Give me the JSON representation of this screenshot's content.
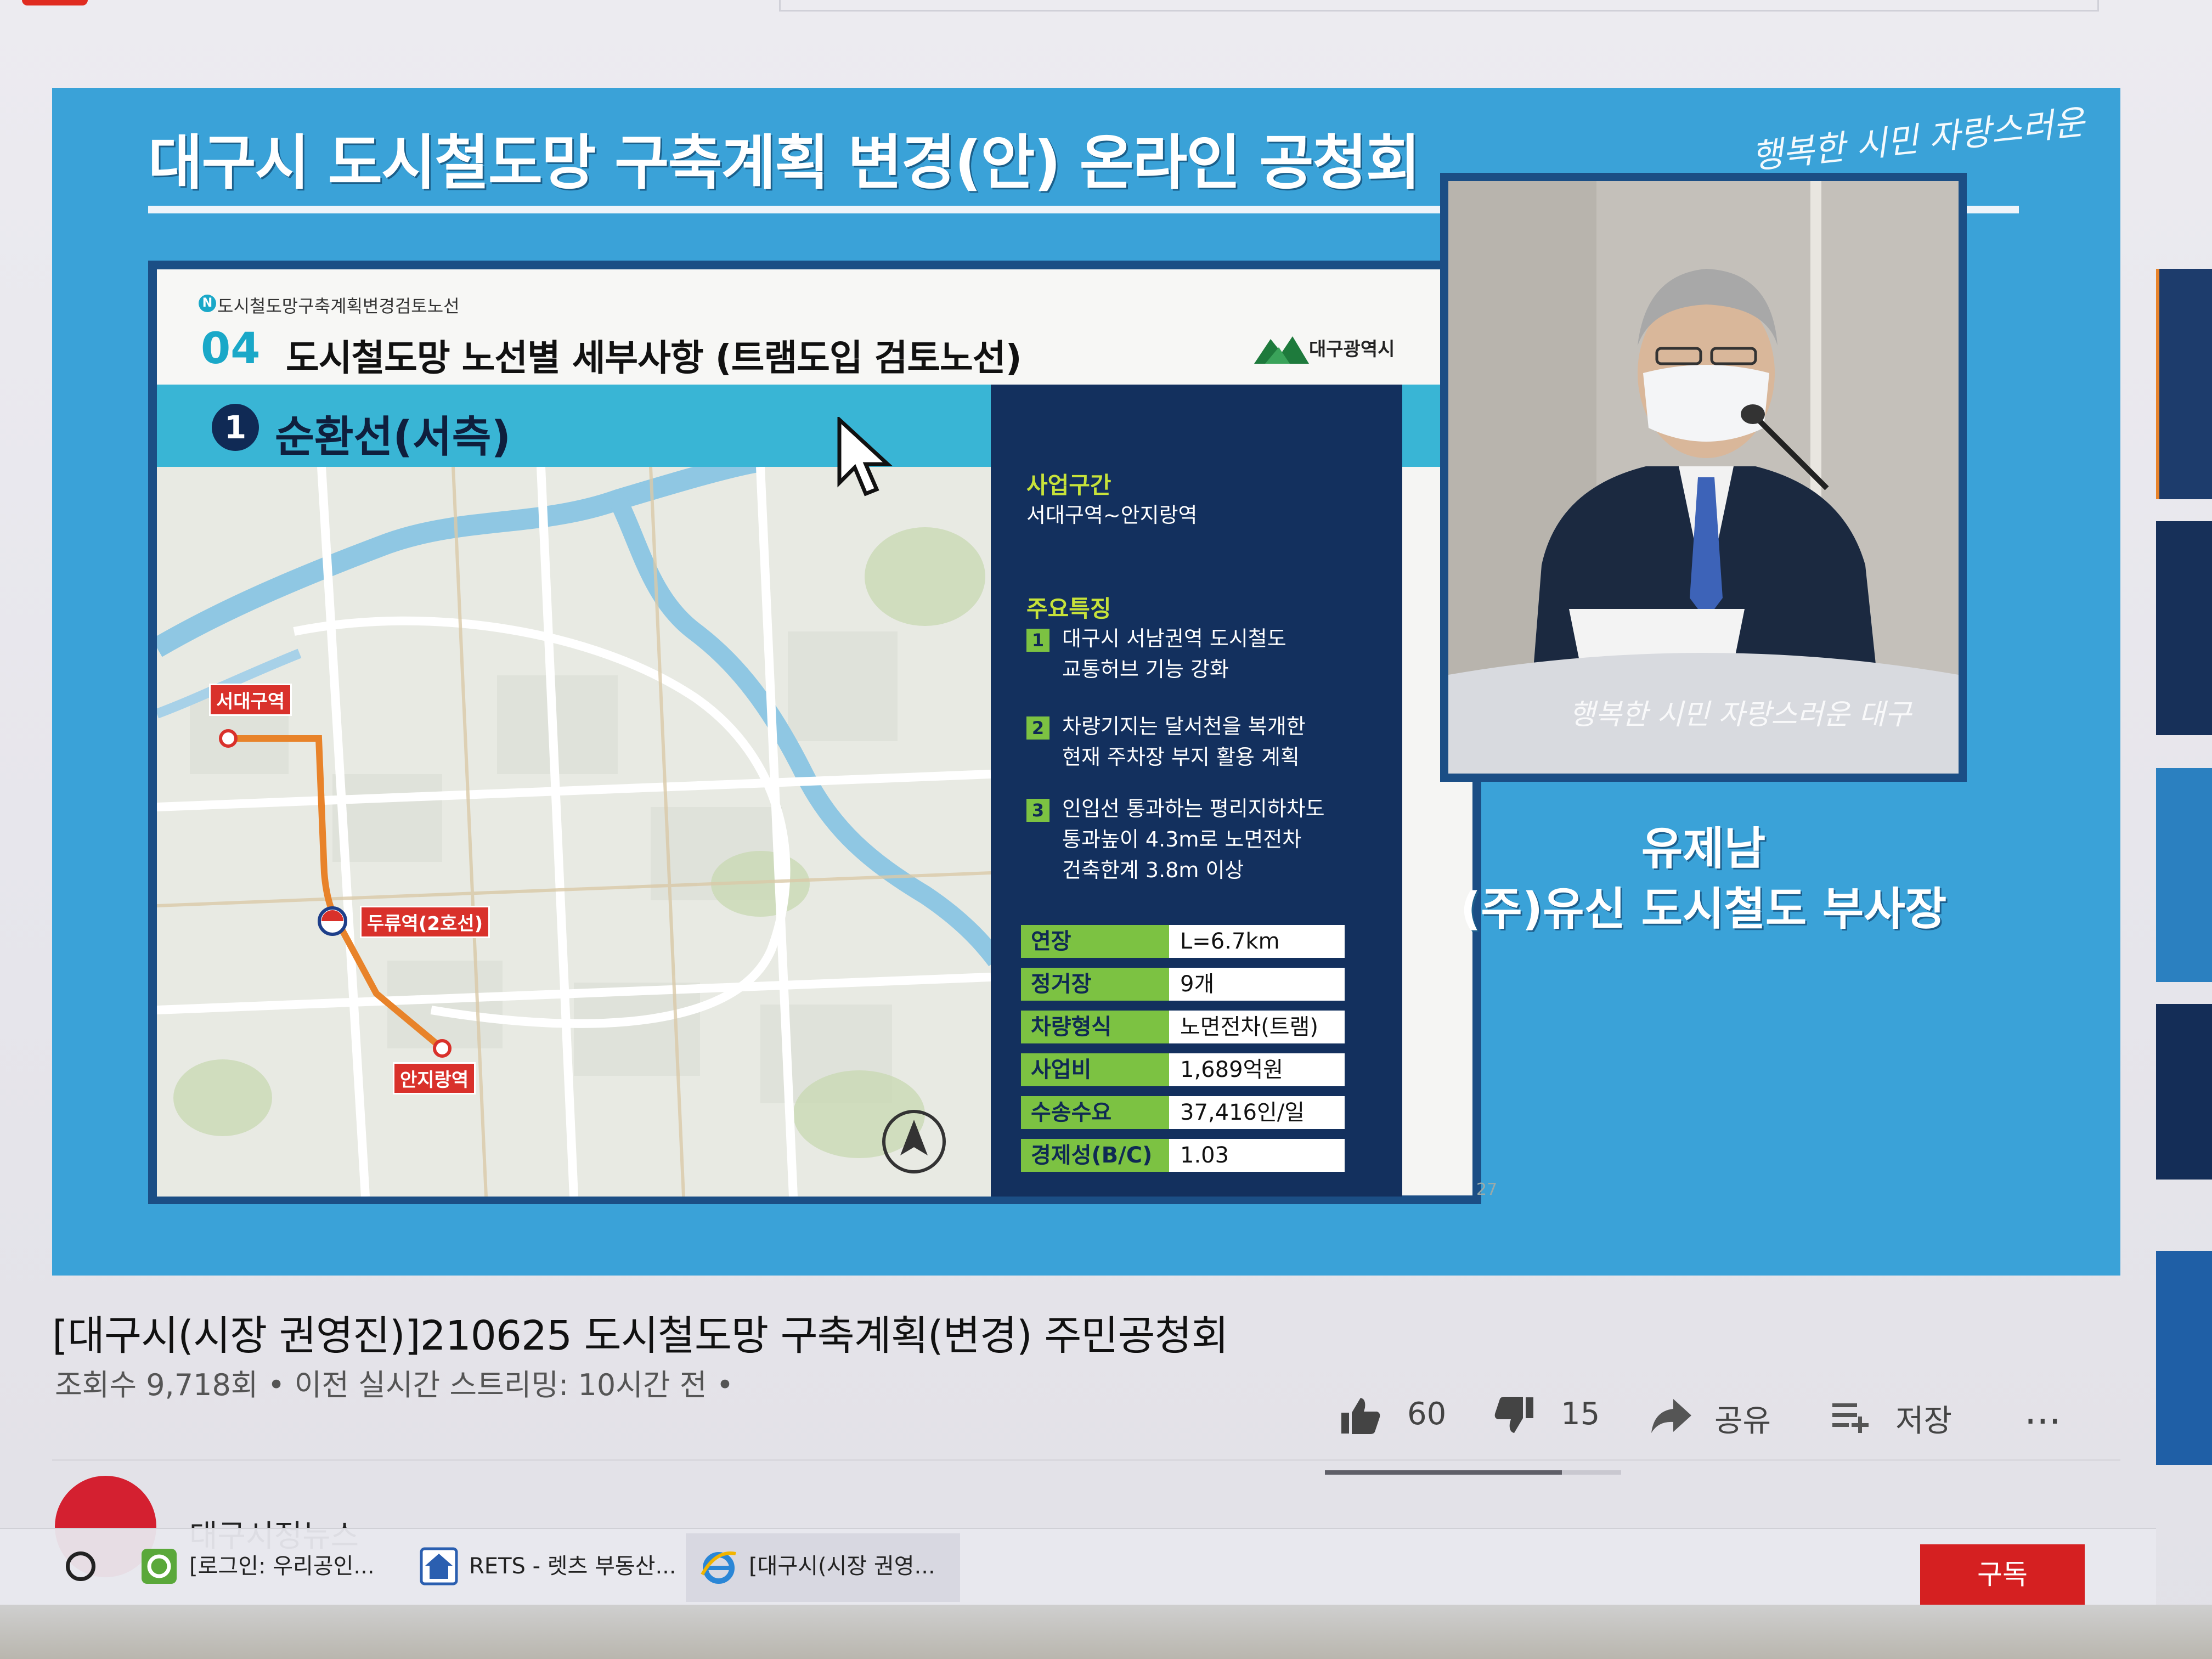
{
  "video_overlay": {
    "title": "대구시 도시철도망 구축계획 변경(안) 온라인 공청회",
    "brand_script": "행복한 시민 자랑스러운 대구"
  },
  "slide": {
    "crumb": "도시철도망구축계획변경검토노선",
    "number": "04",
    "heading": "도시철도망 노선별 세부사항 (트램도입 검토노선)",
    "city_logo": "대구광역시",
    "route_no": "1",
    "route_title": "순환선(서측)",
    "map_labels": {
      "station_a": "서대구역",
      "station_b": "두류역(2호선)",
      "station_c": "안지랑역"
    },
    "section_label": "사업구간",
    "section_value": "서대구역~안지랑역",
    "features_label": "주요특징",
    "features": [
      {
        "n": "1",
        "line1": "대구시 서남권역 도시철도",
        "line2": "교통허브 기능 강화"
      },
      {
        "n": "2",
        "line1": "차량기지는 달서천을 복개한",
        "line2": "현재 주차장 부지 활용 계획"
      },
      {
        "n": "3",
        "line1": "인입선 통과하는 평리지하차도",
        "line2": "통과높이 4.3m로 노면전차",
        "line3": "건축한계 3.8m 이상"
      }
    ],
    "table": [
      {
        "k": "연장",
        "v": "L=6.7km"
      },
      {
        "k": "정거장",
        "v": "9개"
      },
      {
        "k": "차량형식",
        "v": "노면전차(트램)"
      },
      {
        "k": "사업비",
        "v": "1,689억원"
      },
      {
        "k": "수송수요",
        "v": "37,416인/일"
      },
      {
        "k": "경제성(B/C)",
        "v": "1.03"
      }
    ],
    "page_no": "27"
  },
  "speaker": {
    "name": "유제남",
    "role": "(주)유신 도시철도 부사장"
  },
  "video_info": {
    "title": "[대구시(시장 권영진)]210625 도시철도망 구축계획(변경) 주민공청회",
    "meta": "조회수 9,718회 • 이전 실시간 스트리밍: 10시간 전 •",
    "likes": "60",
    "dislikes": "15",
    "share": "공유",
    "save": "저장",
    "more": "...",
    "like_ratio": 0.8
  },
  "channel": {
    "name": "대구시정뉴스",
    "subscribe": "구독"
  },
  "taskbar": [
    {
      "label": "[로그인: 우리공인...",
      "icon": "browser-green-icon"
    },
    {
      "label": "RETS - 렛츠 부동산...",
      "icon": "house-icon"
    },
    {
      "label": "[대구시(시장 권영...",
      "icon": "ie-icon"
    }
  ],
  "colors": {
    "video_bg": "#3aa2d8",
    "slide_accent": "#39b5d5",
    "info_bg": "#13305e",
    "green": "#7cc242",
    "route_line": "#e8832a",
    "station_label": "#d9312b"
  }
}
